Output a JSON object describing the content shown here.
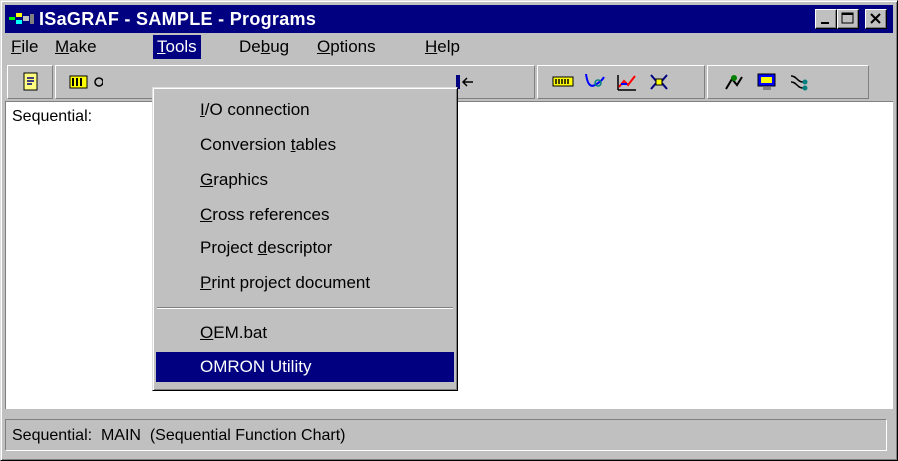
{
  "window": {
    "title": "ISaGRAF - SAMPLE - Programs",
    "icon": "isagraf-app-icon",
    "controls": [
      "minimize",
      "maximize",
      "close"
    ]
  },
  "menubar": {
    "items": [
      {
        "pre": "",
        "key": "F",
        "post": "ile"
      },
      {
        "pre": "",
        "key": "M",
        "post": "ake"
      },
      {
        "pre": "",
        "key": "T",
        "post": "ools"
      },
      {
        "pre": "De",
        "key": "b",
        "post": "ug"
      },
      {
        "pre": "",
        "key": "O",
        "post": "ptions"
      },
      {
        "pre": "",
        "key": "H",
        "post": "elp"
      }
    ],
    "open_item": "Tools"
  },
  "toolbar": {
    "icons": [
      "new-program-icon",
      "dictionary-icon",
      "link-icon",
      "step-icon",
      "io-wiring-icon",
      "curve-icon",
      "graph-icon",
      "simulate-icon",
      "debug-icon",
      "monitor-icon",
      "network-icon"
    ]
  },
  "content": {
    "label": "Sequential:"
  },
  "tools_menu": {
    "items": [
      {
        "pre": "",
        "key": "I",
        "post": "/O connection"
      },
      {
        "pre": "Conversion ",
        "key": "t",
        "post": "ables"
      },
      {
        "pre": "",
        "key": "G",
        "post": "raphics"
      },
      {
        "pre": "",
        "key": "C",
        "post": "ross references"
      },
      {
        "pre": "Project ",
        "key": "d",
        "post": "escriptor"
      },
      {
        "pre": "",
        "key": "P",
        "post": "rint project document"
      },
      {
        "pre": "",
        "key": "O",
        "post": "EM.bat"
      },
      {
        "pre": "",
        "key": "",
        "post": "OMRON Utility"
      }
    ],
    "highlighted": "OMRON Utility"
  },
  "statusbar": {
    "text": "Sequential:  MAIN  (Sequential Function Chart)"
  },
  "colors": {
    "titlebar": "#000080",
    "face": "#c0c0c0",
    "highlight": "#000080"
  }
}
